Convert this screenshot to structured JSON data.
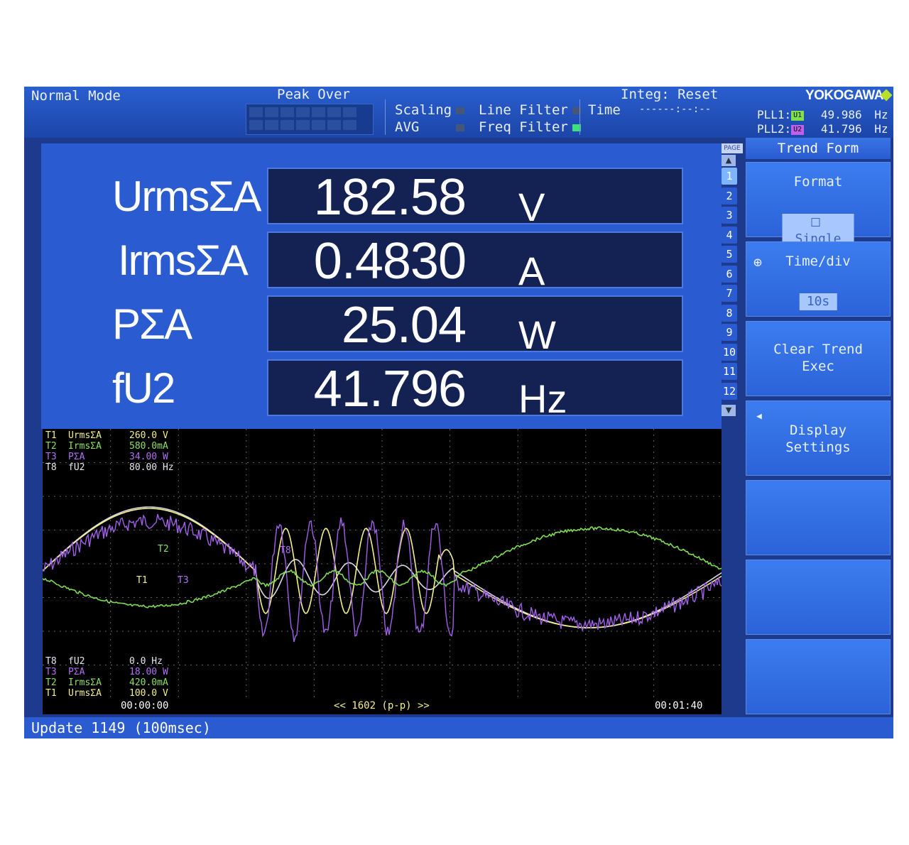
{
  "header": {
    "mode": "Normal Mode",
    "peak_over": "Peak Over",
    "scaling": "Scaling",
    "avg": "AVG",
    "line_filter": "Line Filter",
    "freq_filter": "Freq Filter",
    "time_label": "Time",
    "integ": "Integ: Reset",
    "time_value": "------:--:--",
    "brand": "YOKOGAWA",
    "pll1_label": "PLL1:",
    "pll1_tag": "U1",
    "pll1_value": "49.986",
    "pll1_unit": "Hz",
    "pll2_label": "PLL2:",
    "pll2_tag": "U2",
    "pll2_value": "41.796",
    "pll2_unit": "Hz"
  },
  "readings": [
    {
      "label": "UrmsΣA",
      "value": "182.58",
      "unit": "V"
    },
    {
      "label": "IrmsΣA",
      "value": "0.4830",
      "unit": "A"
    },
    {
      "label": "PΣA",
      "value": "25.04",
      "unit": "W"
    },
    {
      "label": "fU2",
      "value": "41.796",
      "unit": "Hz"
    }
  ],
  "pages": {
    "header": "PAGE",
    "items": [
      "1",
      "2",
      "3",
      "4",
      "5",
      "6",
      "7",
      "8",
      "9",
      "10",
      "11",
      "12"
    ],
    "active": "1"
  },
  "trend": {
    "legend_top": [
      {
        "id": "T1",
        "name": "UrmsΣA",
        "value": "260.0 V",
        "color": "#f4f08a"
      },
      {
        "id": "T2",
        "name": "IrmsΣA",
        "value": "580.0mA",
        "color": "#8ee060"
      },
      {
        "id": "T3",
        "name": "PΣA",
        "value": "34.00 W",
        "color": "#b070f0"
      },
      {
        "id": "T8",
        "name": "fU2",
        "value": "80.00 Hz",
        "color": "#e8e8f0"
      }
    ],
    "legend_bottom": [
      {
        "id": "T8",
        "name": "fU2",
        "value": "0.0 Hz",
        "color": "#e8e8f0"
      },
      {
        "id": "T3",
        "name": "PΣA",
        "value": "18.00 W",
        "color": "#b070f0"
      },
      {
        "id": "T2",
        "name": "IrmsΣA",
        "value": "420.0mA",
        "color": "#8ee060"
      },
      {
        "id": "T1",
        "name": "UrmsΣA",
        "value": "100.0 V",
        "color": "#f4f08a"
      }
    ],
    "trace_labels": {
      "t1": "T1",
      "t2": "T2",
      "t3": "T3",
      "t8": "T8"
    },
    "time_start": "00:00:00",
    "time_end": "00:01:40",
    "points_label": "<< 1602 (p-p) >>"
  },
  "menu": {
    "title": "Trend Form",
    "format_label": "Format",
    "format_value": "Single",
    "timediv_label": "Time/div",
    "timediv_value": "10s",
    "clear_label_1": "Clear Trend",
    "clear_label_2": "Exec",
    "display_label_1": "Display",
    "display_label_2": "Settings"
  },
  "status": {
    "update": "Update  1149 (100msec)"
  }
}
